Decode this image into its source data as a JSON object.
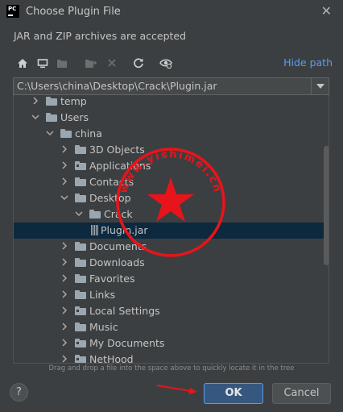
{
  "window": {
    "title": "Choose Plugin File",
    "app_icon_text": "PC"
  },
  "subtitle": "JAR and ZIP archives are accepted",
  "toolbar": {
    "icons": [
      "home-icon",
      "desktop-icon",
      "project-icon",
      "new-folder-icon",
      "delete-icon",
      "refresh-icon",
      "show-hidden-icon"
    ],
    "hide_path_label": "Hide path"
  },
  "path": {
    "value": "C:\\Users\\china\\Desktop\\Crack\\Plugin.jar"
  },
  "tree": {
    "items": [
      {
        "label": "temp",
        "expanded": false,
        "kind": "folder"
      },
      {
        "label": "Users",
        "expanded": true,
        "kind": "folder"
      },
      {
        "label": "china",
        "expanded": true,
        "kind": "folder"
      },
      {
        "label": "3D Objects",
        "expanded": false,
        "kind": "folder"
      },
      {
        "label": "Applications",
        "expanded": false,
        "kind": "folder-link"
      },
      {
        "label": "Contacts",
        "expanded": false,
        "kind": "folder"
      },
      {
        "label": "Desktop",
        "expanded": true,
        "kind": "folder"
      },
      {
        "label": "Crack",
        "expanded": true,
        "kind": "folder"
      },
      {
        "label": "Plugin.jar",
        "kind": "jar",
        "selected": true
      },
      {
        "label": "Documents",
        "expanded": false,
        "kind": "folder"
      },
      {
        "label": "Downloads",
        "expanded": false,
        "kind": "folder"
      },
      {
        "label": "Favorites",
        "expanded": false,
        "kind": "folder"
      },
      {
        "label": "Links",
        "expanded": false,
        "kind": "folder"
      },
      {
        "label": "Local Settings",
        "expanded": false,
        "kind": "folder-link"
      },
      {
        "label": "Music",
        "expanded": false,
        "kind": "folder"
      },
      {
        "label": "My Documents",
        "expanded": false,
        "kind": "folder-link"
      },
      {
        "label": "NetHood",
        "expanded": false,
        "kind": "folder-link"
      }
    ]
  },
  "hint": "Drag and drop a file into the space above to quickly locate it in the tree",
  "buttons": {
    "help": "?",
    "ok": "OK",
    "cancel": "Cancel"
  },
  "watermark": {
    "text": "www.yishimei.cn",
    "color": "#e8141b"
  }
}
